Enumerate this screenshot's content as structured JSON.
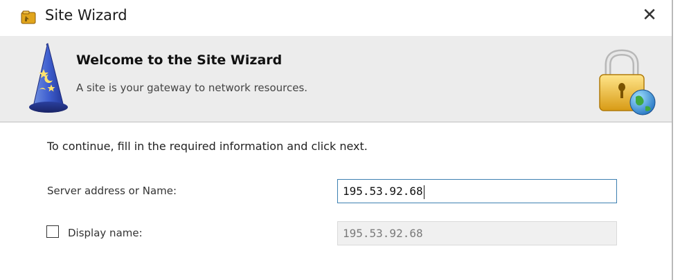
{
  "window": {
    "title": "Site Wizard",
    "close_symbol": "✕"
  },
  "icons": {
    "app": "site-wizard-app-icon",
    "wizard": "wizard-hat-icon",
    "lock": "padlock-globe-icon",
    "close": "close-icon"
  },
  "header": {
    "title": "Welcome to the Site Wizard",
    "subtitle": "A site is your gateway to network resources."
  },
  "form": {
    "instructions": "To continue, fill in the required information and click next.",
    "server": {
      "label": "Server address or Name:",
      "value": "195.53.92.68"
    },
    "display": {
      "checked": false,
      "label": "Display name:",
      "value": "195.53.92.68"
    }
  },
  "colors": {
    "banner_bg": "#ececec",
    "input_focus_border": "#3c7fb1",
    "disabled_input_bg": "#f0f0f0"
  }
}
